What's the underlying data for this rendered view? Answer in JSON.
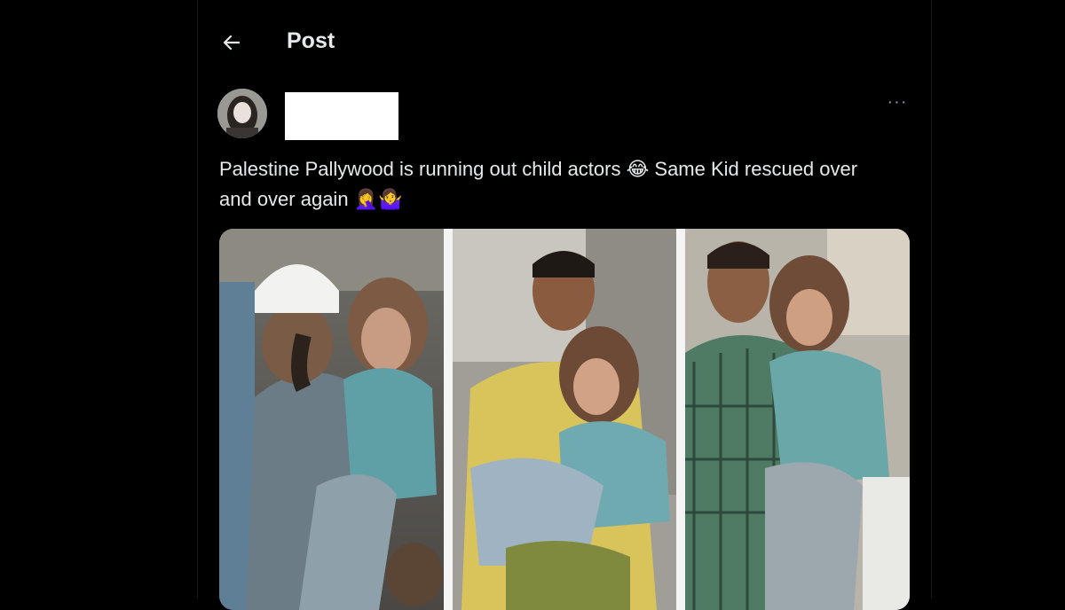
{
  "header": {
    "back_icon": "arrow-left-icon",
    "title": "Post"
  },
  "post": {
    "avatar_icon": "avatar-photo",
    "author_redacted": true,
    "more_icon": "more-horizontal-icon",
    "more_label": "···",
    "text": "Palestine Pallywood is running out child actors 😂 Same Kid rescued over and over again 🤦‍♀️🤷‍♀️",
    "media": {
      "panels": [
        "rescue-photo-1",
        "rescue-photo-2",
        "rescue-photo-3"
      ]
    }
  },
  "colors": {
    "background": "#000000",
    "text": "#e7e9ea",
    "muted": "#8b98a5"
  }
}
